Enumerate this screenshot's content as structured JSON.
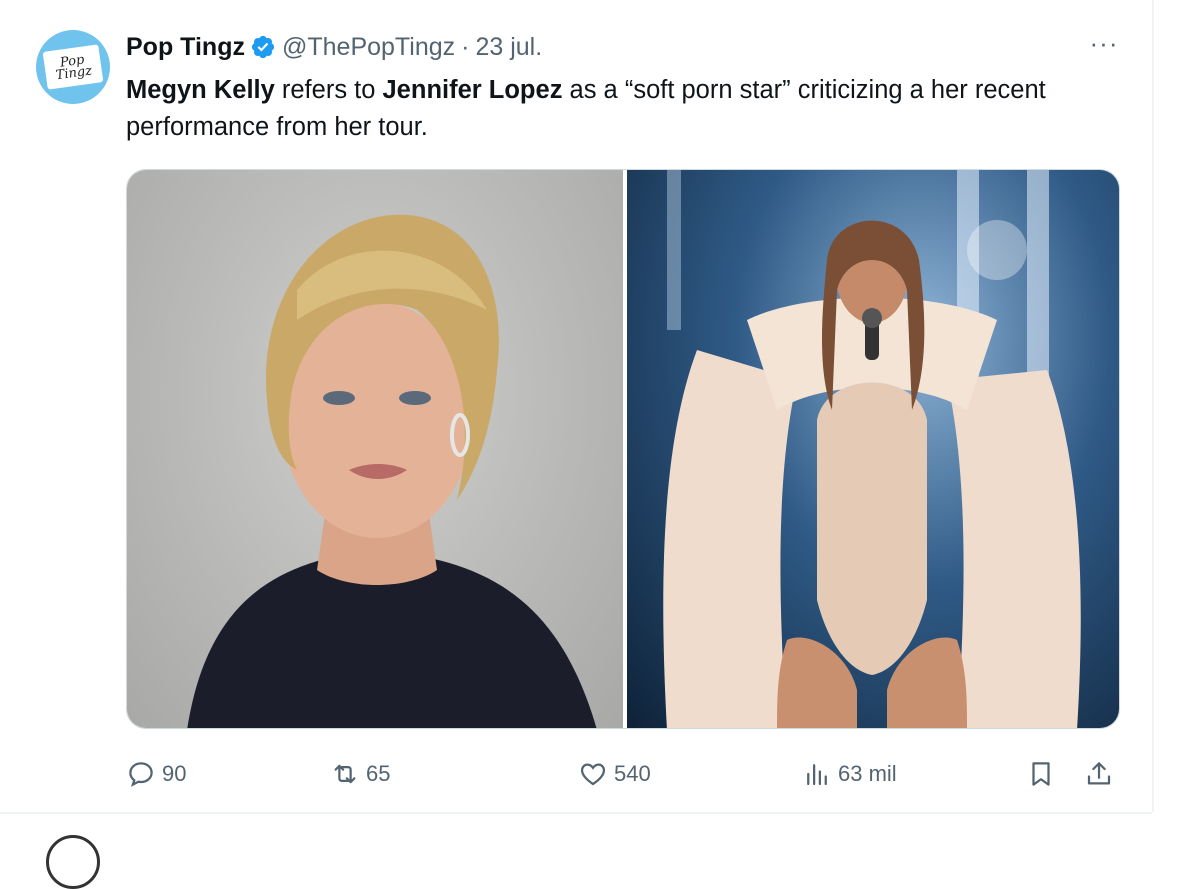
{
  "tweet": {
    "avatar_text": "Pop Tingz",
    "display_name": "Pop Tingz",
    "handle": "@ThePopTingz",
    "separator": "·",
    "date": "23 jul.",
    "more_label": "···",
    "text": {
      "part1_bold": "Megyn Kelly",
      "part2": " refers to ",
      "part3_bold": "Jennifer Lopez",
      "part4": " as a “soft porn star” criticizing a her recent performance from her tour."
    },
    "actions": {
      "replies": "90",
      "reposts": "65",
      "likes": "540",
      "views": "63 mil"
    }
  },
  "colors": {
    "verified_blue": "#1d9bf0",
    "muted_text": "#536471",
    "avatar_bg": "#6fc3ec"
  }
}
